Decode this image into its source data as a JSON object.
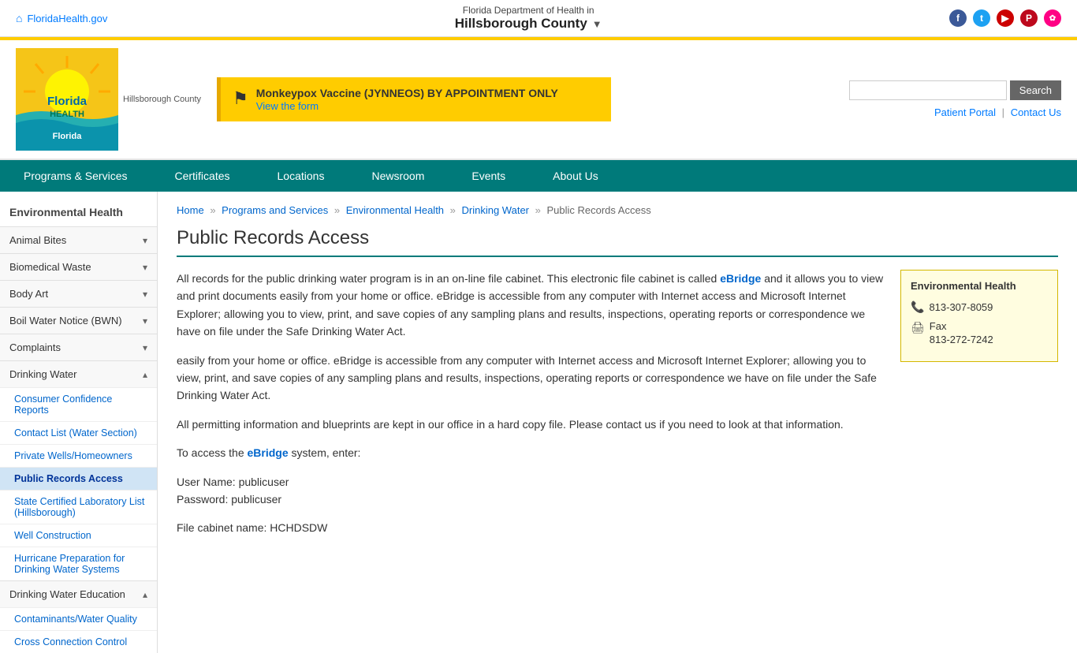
{
  "topbar": {
    "site_link": "FloridaHealth.gov",
    "dept_prefix": "Florida Department of Health in",
    "county": "Hillsborough County",
    "dropdown_label": "▼"
  },
  "header": {
    "search_placeholder": "",
    "search_button": "Search",
    "patient_portal": "Patient Portal",
    "contact_us": "Contact Us",
    "announcement": {
      "title": "Monkeypox Vaccine (JYNNEOS) BY APPOINTMENT ONLY",
      "link_text": "View the form"
    }
  },
  "nav": {
    "items": [
      "Programs & Services",
      "Certificates",
      "Locations",
      "Newsroom",
      "Events",
      "About Us"
    ]
  },
  "sidebar": {
    "title": "Environmental Health",
    "sections": [
      {
        "label": "Animal Bites",
        "expanded": false,
        "items": []
      },
      {
        "label": "Biomedical Waste",
        "expanded": false,
        "items": []
      },
      {
        "label": "Body Art",
        "expanded": false,
        "items": []
      },
      {
        "label": "Boil Water Notice (BWN)",
        "expanded": false,
        "items": []
      },
      {
        "label": "Complaints",
        "expanded": false,
        "items": []
      },
      {
        "label": "Drinking Water",
        "expanded": true,
        "items": [
          "Consumer Confidence Reports",
          "Contact List (Water Section)",
          "Private Wells/Homeowners",
          "Public Records Access",
          "State Certified Laboratory List (Hillsborough)",
          "Well Construction",
          "Hurricane Preparation for Drinking Water Systems"
        ]
      },
      {
        "label": "Drinking Water Education",
        "expanded": true,
        "items": [
          "Contaminants/Water Quality",
          "Cross Connection Control"
        ]
      }
    ]
  },
  "breadcrumb": {
    "home": "Home",
    "programs": "Programs and Services",
    "env_health": "Environmental Health",
    "drinking_water": "Drinking Water",
    "current": "Public Records Access"
  },
  "page_title": "Public Records Access",
  "content": {
    "para1": "All records for the public drinking water program is in an on-line file cabinet. This electronic file cabinet is called ",
    "ebridge_link1": "eBridge",
    "para1b": " and it allows you to view and print documents easily from your home or office. eBridge is accessible from any computer with Internet access and Microsoft Internet Explorer; allowing you to view, print, and save copies of any sampling plans and results, inspections, operating reports or correspondence we have on file under the Safe Drinking Water Act.",
    "para2": "easily from your home or office. eBridge is accessible from any computer with Internet access and Microsoft Internet Explorer; allowing you to view, print, and save copies of any sampling plans and results, inspections, operating reports or correspondence we have on file under the Safe Drinking Water Act.",
    "para3": "All permitting information and blueprints are kept in our office in a hard copy file. Please contact us if you need to look at that information.",
    "para4_prefix": "To access the ",
    "ebridge_link2": "eBridge",
    "para4_suffix": " system, enter:",
    "credentials": "User Name: publicuser\nPassword: publicuser",
    "file_cabinet": "File cabinet name: HCHDSDW"
  },
  "side_box": {
    "title": "Environmental Health",
    "phone": "813-307-8059",
    "fax_label": "Fax",
    "fax": "813-272-7242"
  },
  "colors": {
    "teal": "#007a7a",
    "yellow": "#ffcc00",
    "link": "#0066cc"
  }
}
